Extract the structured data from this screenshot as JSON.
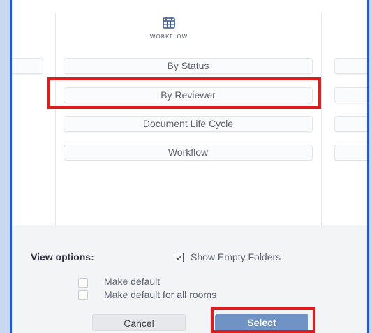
{
  "workflow_column": {
    "icon": "calendar-icon",
    "heading": "WORKFLOW",
    "items": [
      {
        "label": "By Status"
      },
      {
        "label": "By Reviewer"
      },
      {
        "label": "Document Life Cycle"
      },
      {
        "label": "Workflow"
      }
    ]
  },
  "view_options": {
    "label": "View options:",
    "show_empty_folders": {
      "label": "Show Empty Folders",
      "checked": true
    },
    "make_default": {
      "label": "Make default",
      "checked": false
    },
    "make_default_all_rooms": {
      "label": "Make default for all rooms",
      "checked": false
    }
  },
  "footer": {
    "cancel_label": "Cancel",
    "select_label": "Select"
  },
  "colors": {
    "frame_border": "#1e5ad0",
    "highlight": "#e21a1a",
    "select_button": "#6f93c4"
  }
}
